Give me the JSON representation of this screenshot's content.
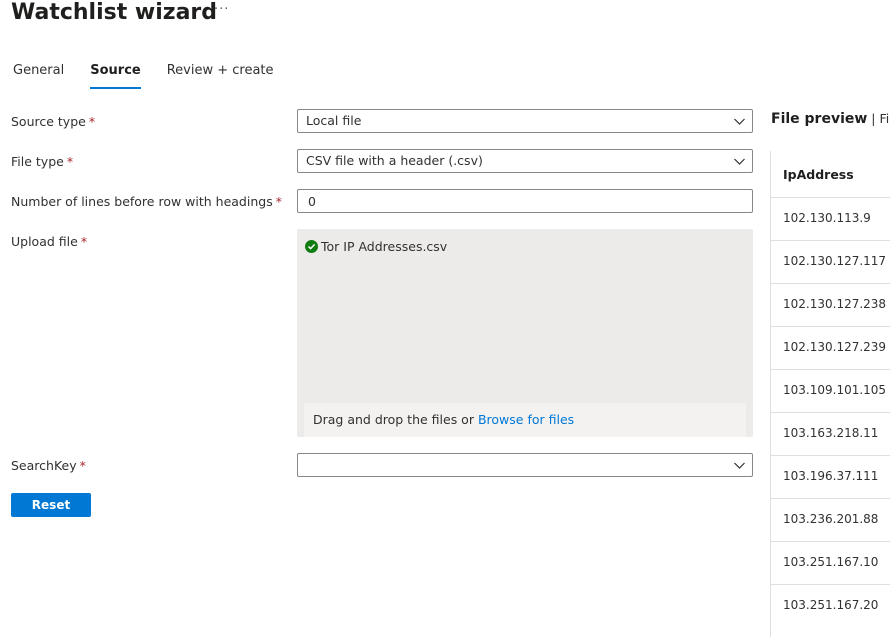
{
  "header": {
    "title": "Watchlist wizard",
    "more": "···"
  },
  "tabs": [
    {
      "label": "General"
    },
    {
      "label": "Source"
    },
    {
      "label": "Review + create"
    }
  ],
  "form": {
    "source_type": {
      "label": "Source type",
      "value": "Local file"
    },
    "file_type": {
      "label": "File type",
      "value": "CSV file with a header (.csv)"
    },
    "lines_before": {
      "label": "Number of lines before row with headings",
      "value": "0"
    },
    "upload": {
      "label": "Upload file",
      "file_name": "Tor IP Addresses.csv",
      "drop_text": "Drag and drop the files or ",
      "browse_link": "Browse for files"
    },
    "search_key": {
      "label": "SearchKey",
      "value": ""
    },
    "required_mark": "*",
    "reset_label": "Reset"
  },
  "preview": {
    "title": "File preview",
    "subtitle": " | First",
    "column": "IpAddress",
    "rows": [
      "102.130.113.9",
      "102.130.127.117",
      "102.130.127.238",
      "102.130.127.239",
      "103.109.101.105",
      "103.163.218.11",
      "103.196.37.111",
      "103.236.201.88",
      "103.251.167.10",
      "103.251.167.20"
    ]
  },
  "colors": {
    "accent": "#0078d4",
    "success": "#107c10",
    "required": "#a4262c"
  }
}
